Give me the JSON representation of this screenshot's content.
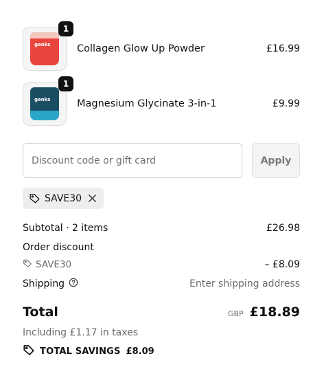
{
  "cart": {
    "items": [
      {
        "name": "Collagen Glow Up Powder",
        "price": "£16.99",
        "quantity": "1",
        "pack_brand": "genks",
        "pack_color": "#e8453c",
        "band_color": "#f4c8c1"
      },
      {
        "name": "Magnesium Glycinate 3-in-1",
        "price": "£9.99",
        "quantity": "1",
        "pack_brand": "genks",
        "pack_color": "#1b4d63",
        "band_color": "#2aa6c9"
      }
    ]
  },
  "discount": {
    "placeholder": "Discount code or gift card",
    "value": "",
    "apply_label": "Apply",
    "applied_code": "SAVE30",
    "remove_icon": "close-icon",
    "tag_icon": "tag-icon"
  },
  "summary": {
    "subtotal_label": "Subtotal · 2 items",
    "subtotal_value": "£26.98",
    "order_discount_label": "Order discount",
    "discount_code": "SAVE30",
    "discount_value": "– £8.09",
    "shipping_label": "Shipping",
    "shipping_value": "Enter shipping address",
    "total_label": "Total",
    "currency": "GBP",
    "total_value": "£18.89",
    "taxes_note": "Including £1.17 in taxes",
    "savings_label": "TOTAL SAVINGS",
    "savings_value": "£8.09"
  },
  "colors": {
    "text": "#111111",
    "muted": "#6b6b6b",
    "border": "#d3d3d3",
    "chip_bg": "#ededed"
  }
}
